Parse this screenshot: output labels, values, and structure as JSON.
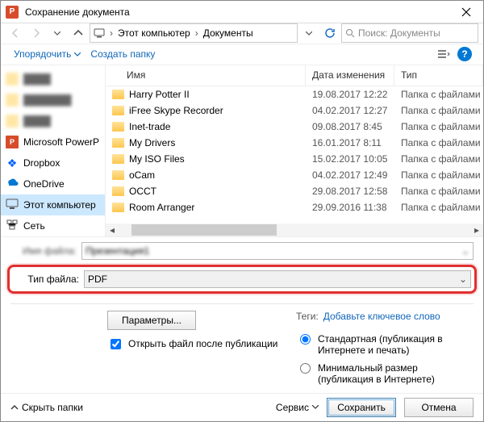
{
  "window": {
    "title": "Сохранение документа"
  },
  "breadcrumb": {
    "segments": [
      "Этот компьютер",
      "Документы"
    ]
  },
  "search": {
    "placeholder": "Поиск: Документы"
  },
  "toolbar": {
    "organize": "Упорядочить",
    "new_folder": "Создать папку"
  },
  "columns": {
    "name": "Имя",
    "date": "Дата изменения",
    "type": "Тип"
  },
  "files": [
    {
      "name": "Harry Potter II",
      "date": "19.08.2017 12:22",
      "type": "Папка с файлами"
    },
    {
      "name": "iFree Skype Recorder",
      "date": "04.02.2017 12:27",
      "type": "Папка с файлами"
    },
    {
      "name": "Inet-trade",
      "date": "09.08.2017 8:45",
      "type": "Папка с файлами"
    },
    {
      "name": "My Drivers",
      "date": "16.01.2017 8:11",
      "type": "Папка с файлами"
    },
    {
      "name": "My ISO Files",
      "date": "15.02.2017 10:05",
      "type": "Папка с файлами"
    },
    {
      "name": "oCam",
      "date": "04.02.2017 12:49",
      "type": "Папка с файлами"
    },
    {
      "name": "OCCT",
      "date": "29.08.2017 12:58",
      "type": "Папка с файлами"
    },
    {
      "name": "Room Arranger",
      "date": "29.09.2016 11:38",
      "type": "Папка с файлами"
    }
  ],
  "sidebar": {
    "items": [
      {
        "label": "Microsoft PowerP",
        "kind": "pp"
      },
      {
        "label": "Dropbox",
        "kind": "dropbox"
      },
      {
        "label": "OneDrive",
        "kind": "onedrive"
      },
      {
        "label": "Этот компьютер",
        "kind": "pc",
        "selected": true
      },
      {
        "label": "Сеть",
        "kind": "net"
      }
    ]
  },
  "form": {
    "filename_label": "Имя файла:",
    "filename_value": "Презентация1",
    "filetype_label": "Тип файла:",
    "filetype_value": "PDF"
  },
  "tags": {
    "label": "Теги:",
    "placeholder": "Добавьте ключевое слово"
  },
  "options": {
    "params_btn": "Параметры...",
    "open_after": "Открыть файл после публикации",
    "radio_standard": "Стандартная (публикация в Интернете и печать)",
    "radio_minimal": "Минимальный размер (публикация в Интернете)"
  },
  "footer": {
    "collapse": "Скрыть папки",
    "service": "Сервис",
    "save": "Сохранить",
    "cancel": "Отмена"
  }
}
